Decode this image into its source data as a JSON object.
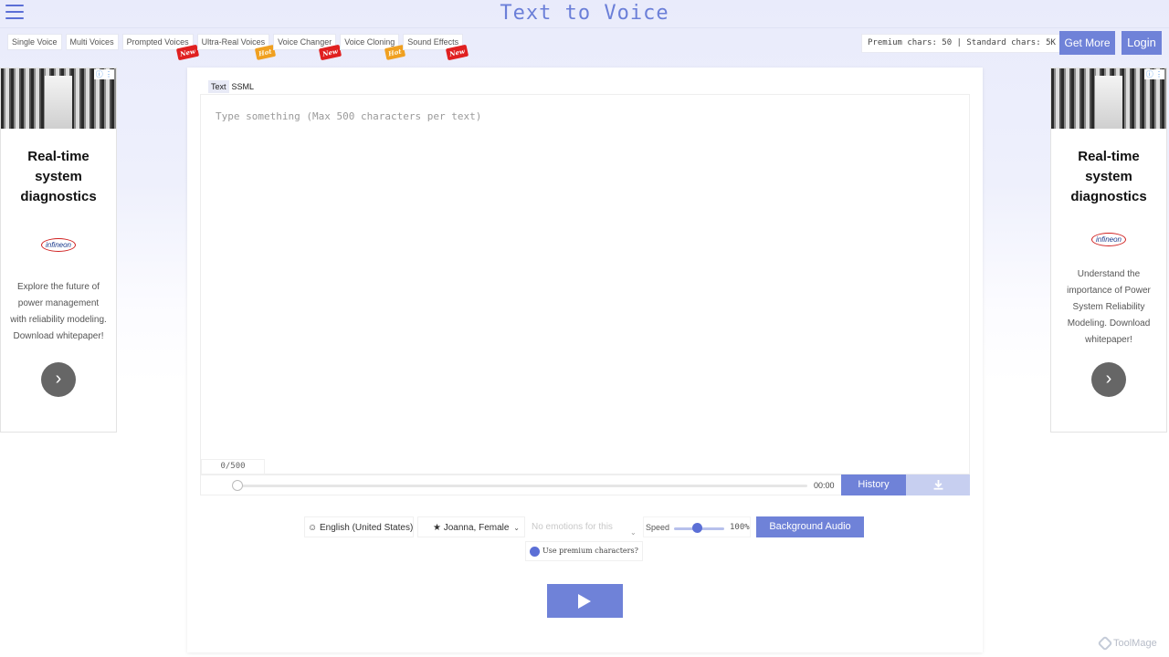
{
  "header": {
    "title": "Text to Voice",
    "premium_chars": "Premium chars: 50 | Standard chars: 5K",
    "get_more_label": "Get More",
    "login_label": "Login"
  },
  "nav": {
    "items": [
      {
        "label": "Single Voice",
        "badge": ""
      },
      {
        "label": "Multi Voices",
        "badge": ""
      },
      {
        "label": "Prompted Voices",
        "badge": "New"
      },
      {
        "label": "Ultra-Real Voices",
        "badge": "Hot"
      },
      {
        "label": "Voice Changer",
        "badge": "New"
      },
      {
        "label": "Voice Cloning",
        "badge": "Hot"
      },
      {
        "label": "Sound Effects",
        "badge": "New"
      }
    ]
  },
  "ads": {
    "left": {
      "headline": "Real-time system diagnostics",
      "logo": "infineon",
      "text": "Explore the future of power management with reliability modeling. Download whitepaper!"
    },
    "right": {
      "headline": "Real-time system diagnostics",
      "logo": "infineon",
      "text": "Understand the importance of Power System Reliability Modeling. Download whitepaper!"
    }
  },
  "editor": {
    "tabs": [
      {
        "label": "Text",
        "active": true
      },
      {
        "label": "SSML",
        "active": false
      }
    ],
    "placeholder": "Type something (Max 500 characters per text)",
    "counter": "0/500"
  },
  "player": {
    "time": "00:00",
    "history_label": "History",
    "download_icon": "download-icon"
  },
  "controls": {
    "language": "English (United States)",
    "voice": "Joanna, Female",
    "emotion_placeholder": "No emotions for this",
    "speed_label": "Speed",
    "speed_value": "100%",
    "speed_fraction": 0.36,
    "background_audio_label": "Background Audio",
    "premium_label": "Use premium characters?"
  },
  "watermark": "ToolMage",
  "colors": {
    "accent": "#6f82d8",
    "accent_dark": "#5b6fd6",
    "badge_new": "#e02020",
    "badge_hot": "#f0a020"
  }
}
